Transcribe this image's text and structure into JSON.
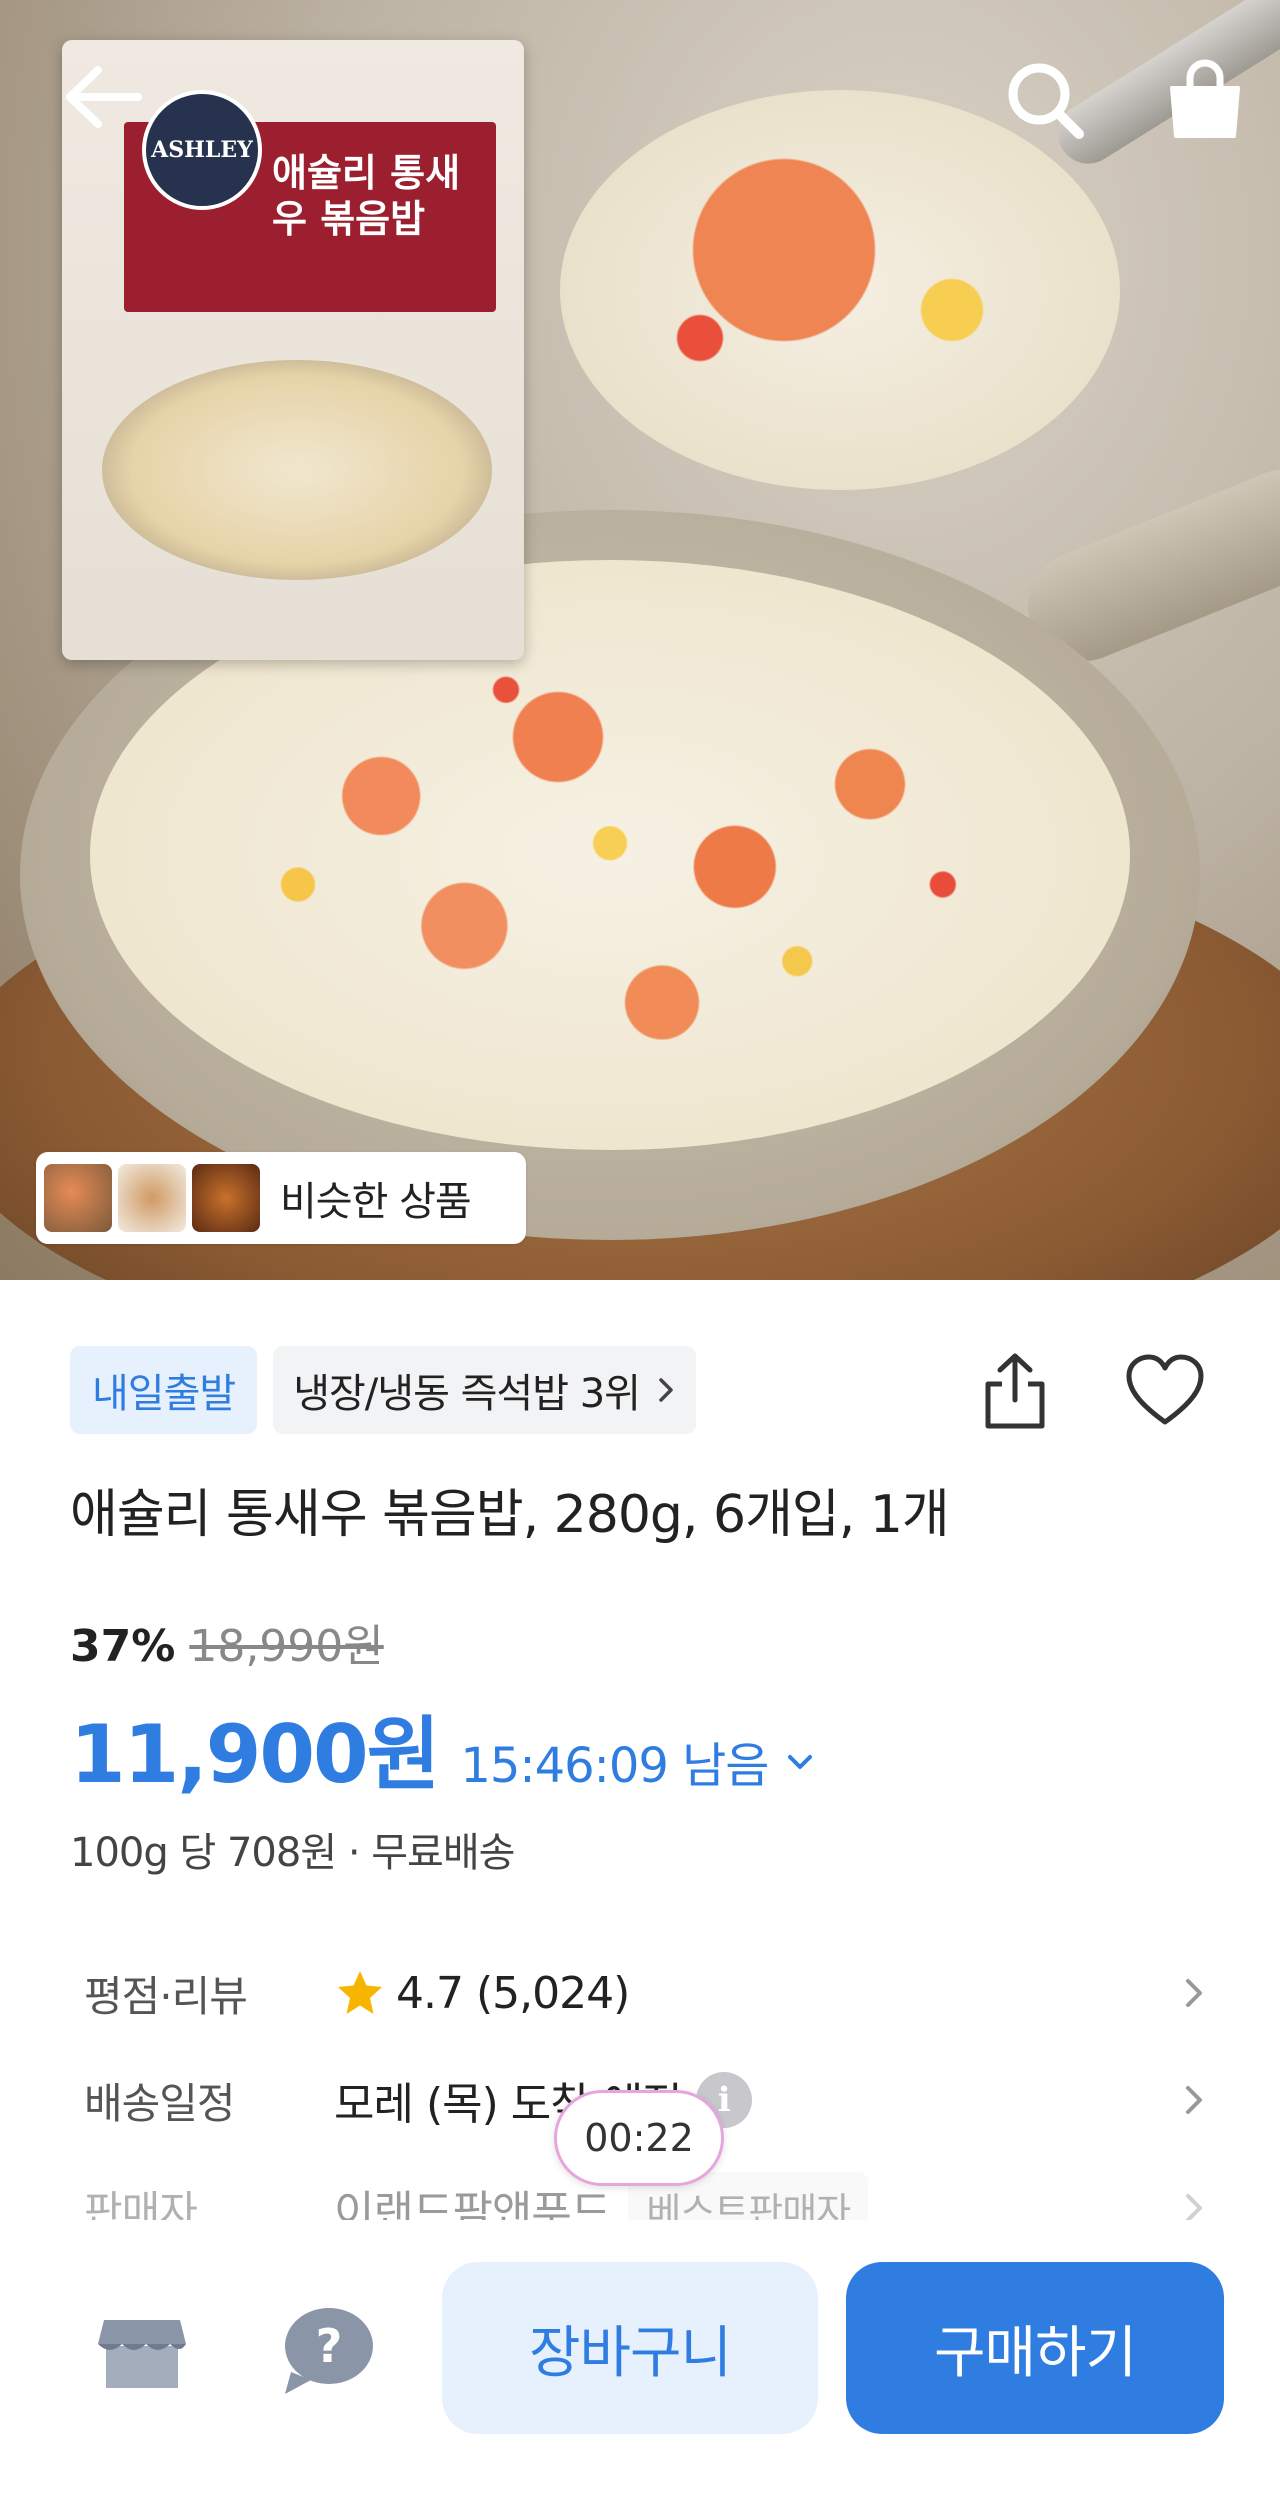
{
  "hero": {
    "package_title": "애슐리 통새우 볶음밥",
    "package_logo": "ASHLEY",
    "similar_products_label": "비슷한 상품"
  },
  "topbar": {
    "icons": [
      "back-arrow-icon",
      "search-icon",
      "shopping-bag-icon"
    ]
  },
  "product": {
    "delivery_badge": "내일출발",
    "ranking_badge": "냉장/냉동 즉석밥 3위",
    "title": "애슐리 통새우 볶음밥, 280g, 6개입, 1개",
    "discount_rate": "37%",
    "original_price": "18,990원",
    "sale_price": "11,900원",
    "time_left": "15:46:09 남음",
    "unit_price": "100g 당 708원 · 무료배송"
  },
  "info_rows": [
    {
      "label": "평점·리뷰",
      "value": "4.7 (5,024)"
    },
    {
      "label": "배송일정",
      "value": "모레 (목) 도착 예정"
    },
    {
      "label": "판매자",
      "value": "이랜드팜앤푸드",
      "badge": "베스트판매자"
    }
  ],
  "video_timer": "00:22",
  "bottom_bar": {
    "cart_label": "장바구니",
    "buy_label": "구매하기"
  },
  "colors": {
    "accent": "#2f7de1",
    "accent_light": "#e7f1fd",
    "star": "#f7b500"
  }
}
